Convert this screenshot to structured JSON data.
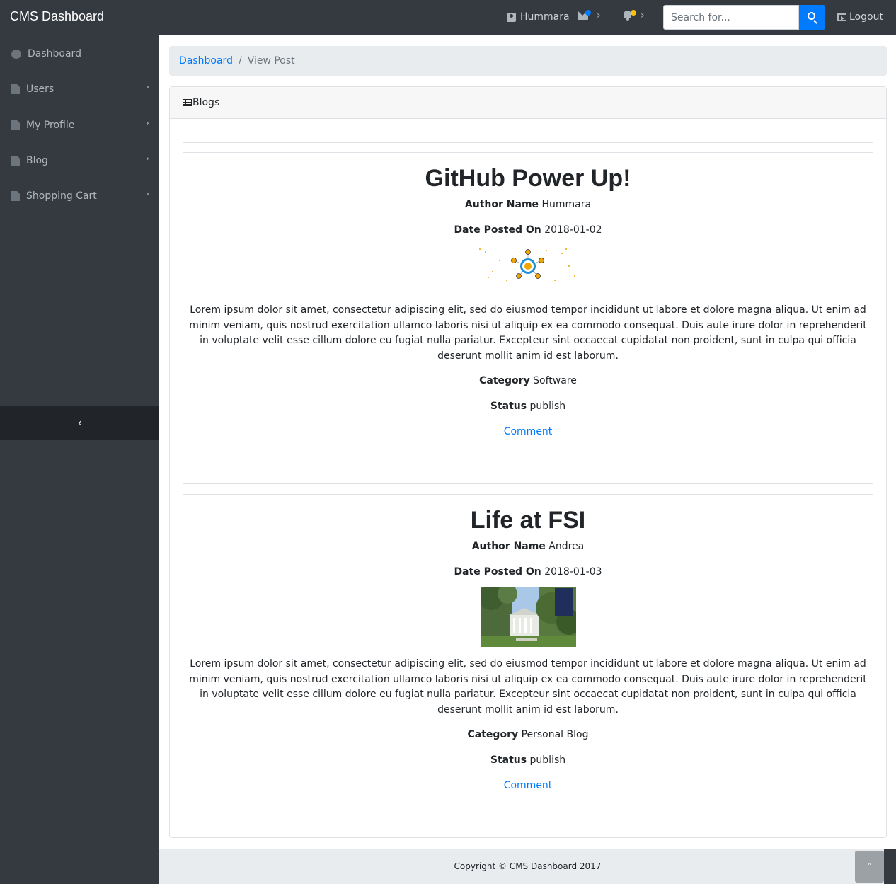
{
  "navbar": {
    "brand": "CMS Dashboard",
    "user": "Hummara",
    "search_placeholder": "Search for...",
    "logout": "Logout",
    "message_dot_color": "#007bff",
    "alert_dot_color": "#ffc107"
  },
  "sidebar": {
    "items": [
      {
        "label": "Dashboard",
        "icon": "dashboard-icon",
        "has_submenu": false
      },
      {
        "label": "Users",
        "icon": "file-icon",
        "has_submenu": true
      },
      {
        "label": "My Profile",
        "icon": "file-icon",
        "has_submenu": true
      },
      {
        "label": "Blog",
        "icon": "file-icon",
        "has_submenu": true
      },
      {
        "label": "Shopping Cart",
        "icon": "file-icon",
        "has_submenu": true
      }
    ]
  },
  "breadcrumb": {
    "link": "Dashboard",
    "current": "View Post"
  },
  "card": {
    "title": "Blogs"
  },
  "posts": [
    {
      "title": "GitHub Power Up!",
      "author_label": "Author Name",
      "author": "Hummara",
      "date_label": "Date Posted On",
      "date": "2018-01-02",
      "body": "Lorem ipsum dolor sit amet, consectetur adipiscing elit, sed do eiusmod tempor incididunt ut labore et dolore magna aliqua. Ut enim ad minim veniam, quis nostrud exercitation ullamco laboris nisi ut aliquip ex ea commodo consequat. Duis aute irure dolor in reprehenderit in voluptate velit esse cillum dolore eu fugiat nulla pariatur. Excepteur sint occaecat cupidatat non proident, sunt in culpa qui officia deserunt mollit anim id est laborum.",
      "category_label": "Category",
      "category": "Software",
      "status_label": "Status",
      "status": "publish",
      "comment": "Comment"
    },
    {
      "title": "Life at FSI",
      "author_label": "Author Name",
      "author": "Andrea",
      "date_label": "Date Posted On",
      "date": "2018-01-03",
      "body": "Lorem ipsum dolor sit amet, consectetur adipiscing elit, sed do eiusmod tempor incididunt ut labore et dolore magna aliqua. Ut enim ad minim veniam, quis nostrud exercitation ullamco laboris nisi ut aliquip ex ea commodo consequat. Duis aute irure dolor in reprehenderit in voluptate velit esse cillum dolore eu fugiat nulla pariatur. Excepteur sint occaecat cupidatat non proident, sunt in culpa qui officia deserunt mollit anim id est laborum.",
      "category_label": "Category",
      "category": "Personal Blog",
      "status_label": "Status",
      "status": "publish",
      "comment": "Comment"
    }
  ],
  "footer": {
    "copyright": "Copyright © CMS Dashboard 2017"
  }
}
